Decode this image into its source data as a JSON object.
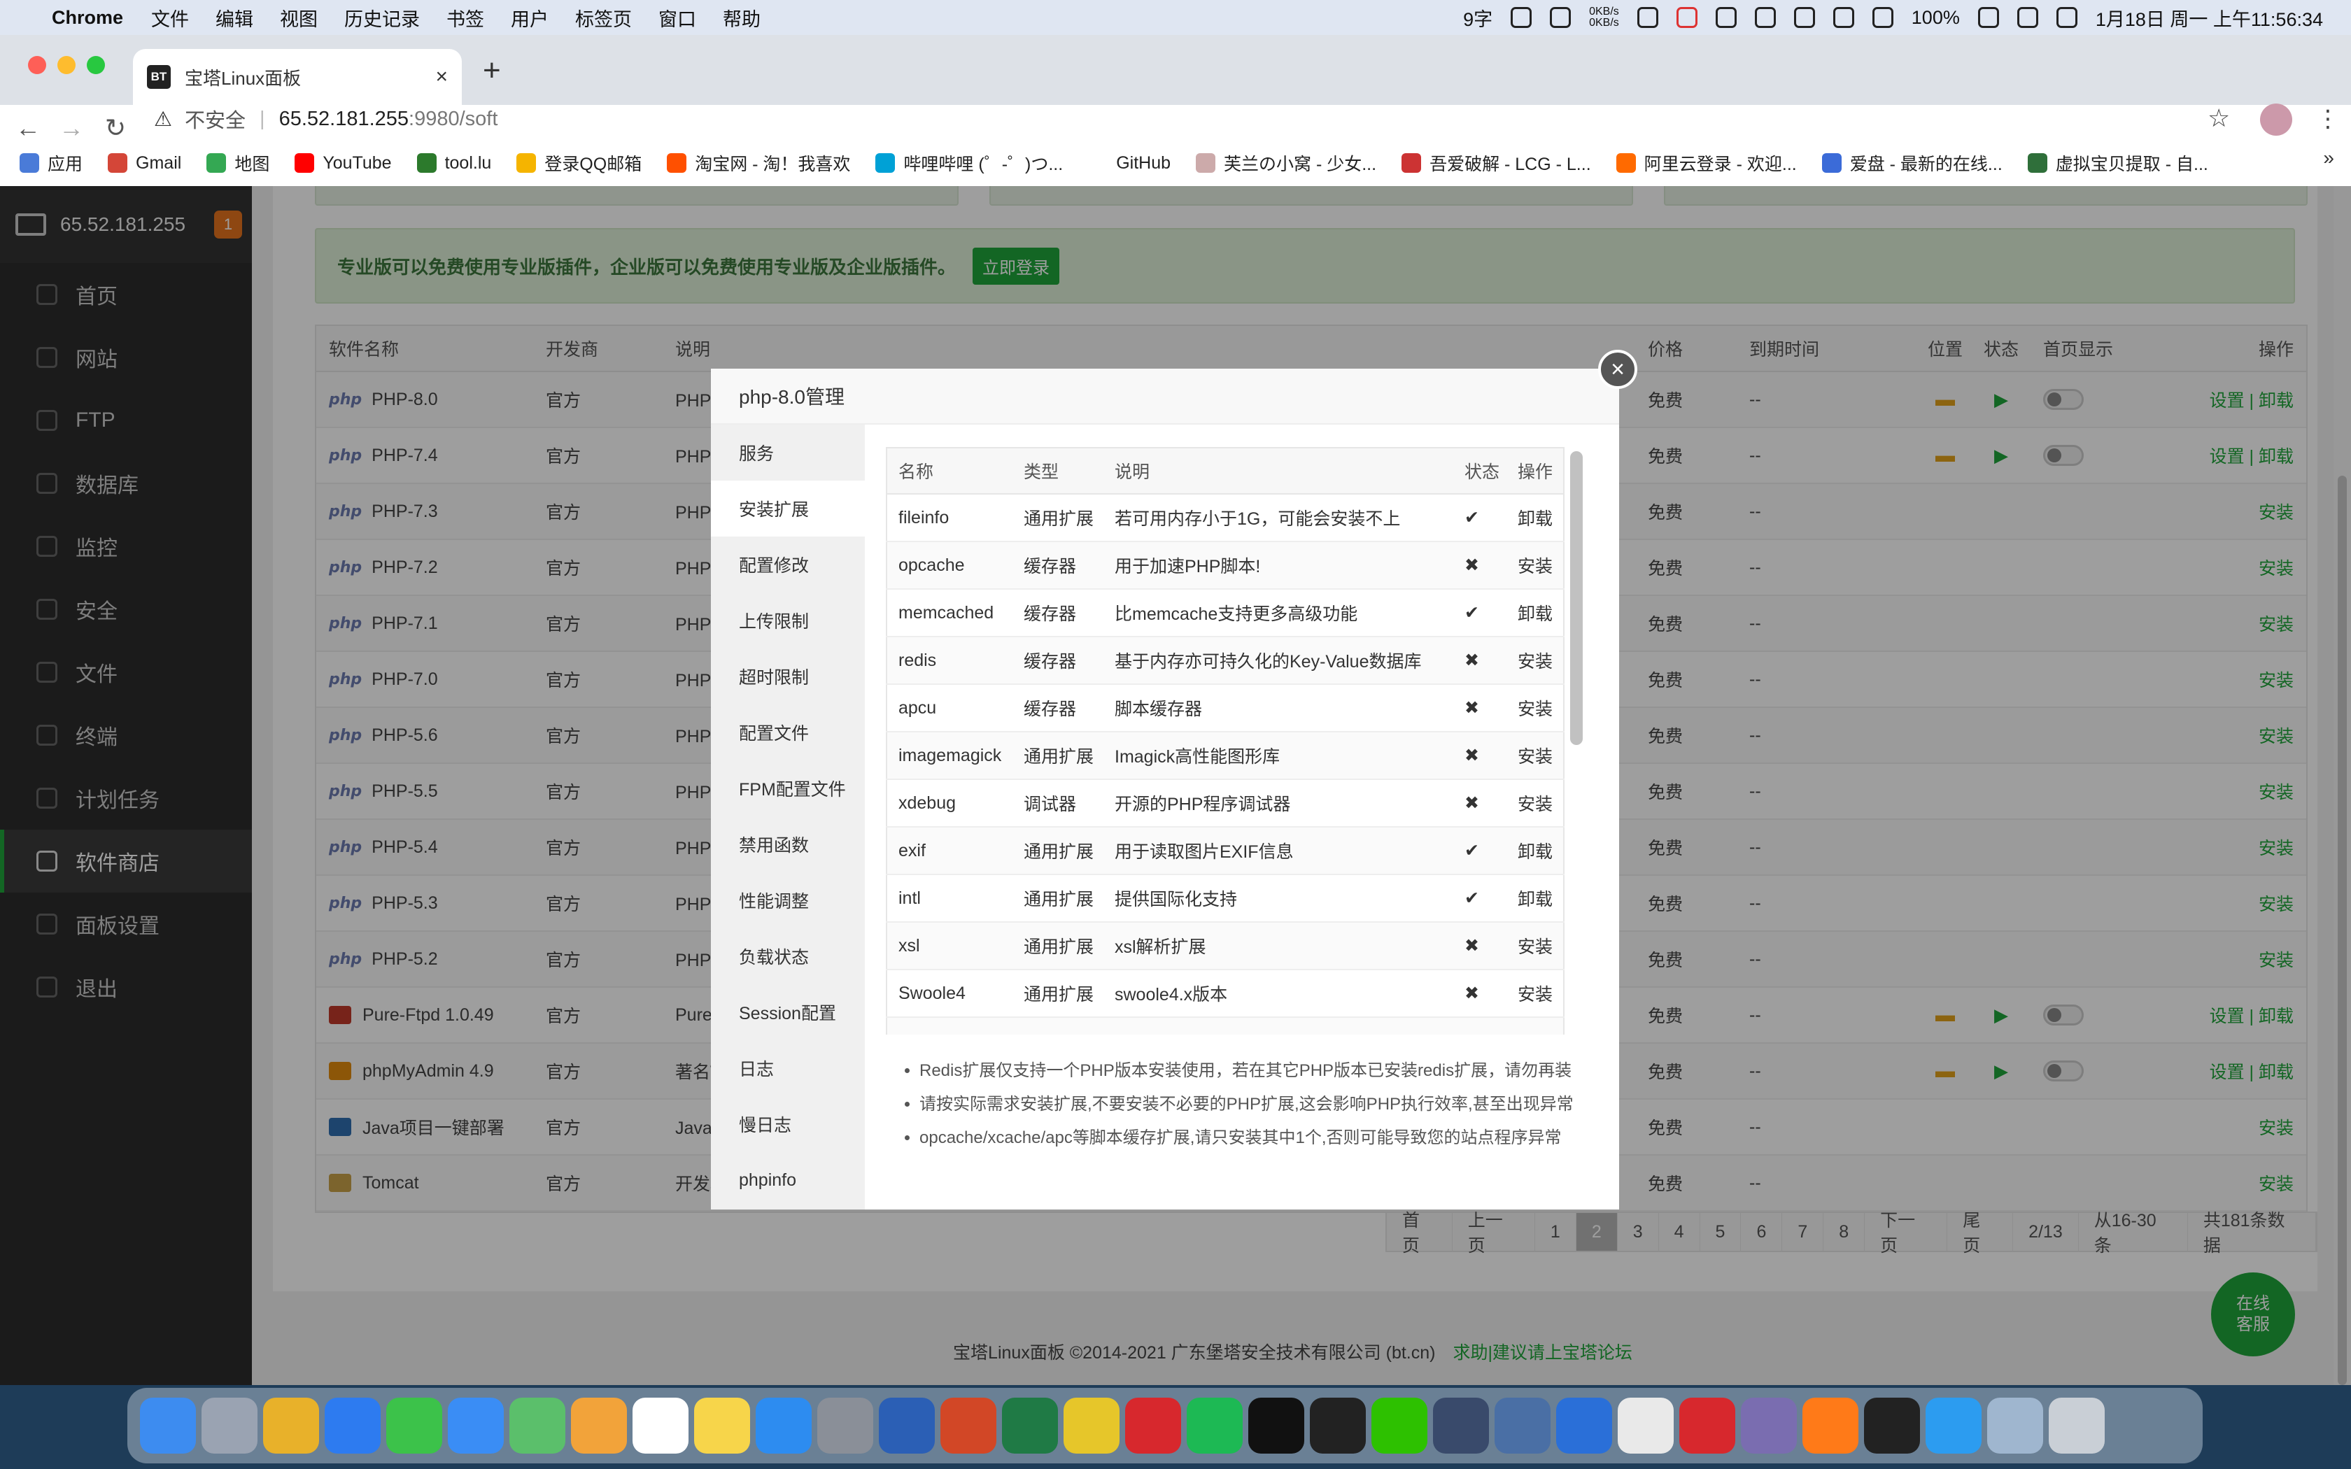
{
  "menubar": {
    "app_name": "Chrome",
    "menus": [
      "文件",
      "编辑",
      "视图",
      "历史记录",
      "书签",
      "用户",
      "标签页",
      "窗口",
      "帮助"
    ],
    "status": {
      "ime": "9字",
      "net": "0KB/s\n0KB/s",
      "battery": "100%",
      "clock": "1月18日 周一 上午11:56:34"
    }
  },
  "browser": {
    "tab_title": "宝塔Linux面板",
    "tab_favicon": "BT",
    "insecure_label": "不安全",
    "url_host": "65.52.181.255",
    "url_path": ":9980/soft",
    "bookmarks": [
      {
        "label": "应用",
        "color": "#4a7bd8"
      },
      {
        "label": "Gmail",
        "color": "#d44638"
      },
      {
        "label": "地图",
        "color": "#34a853"
      },
      {
        "label": "YouTube",
        "color": "#ff0000"
      },
      {
        "label": "tool.lu",
        "color": "#2c7a2c"
      },
      {
        "label": "登录QQ邮箱",
        "color": "#f5b400"
      },
      {
        "label": "淘宝网 - 淘！我喜欢",
        "color": "#ff5000"
      },
      {
        "label": "哔哩哔哩 (゜-゜)つ...",
        "color": "#00a1d6"
      },
      {
        "label": "GitHub",
        "color": "#ffffff"
      },
      {
        "label": "芙兰の小窝 - 少女...",
        "color": "#caa"
      },
      {
        "label": "吾爱破解 - LCG - L...",
        "color": "#c33"
      },
      {
        "label": "阿里云登录 - 欢迎...",
        "color": "#ff6a00"
      },
      {
        "label": "爱盘 - 最新的在线...",
        "color": "#3b6bd8"
      },
      {
        "label": "虚拟宝贝提取 - 自...",
        "color": "#2f6f3a"
      }
    ]
  },
  "sidebar": {
    "server_ip": "65.52.181.255",
    "badge": "1",
    "items": [
      {
        "label": "首页"
      },
      {
        "label": "网站"
      },
      {
        "label": "FTP"
      },
      {
        "label": "数据库"
      },
      {
        "label": "监控"
      },
      {
        "label": "安全"
      },
      {
        "label": "文件"
      },
      {
        "label": "终端"
      },
      {
        "label": "计划任务"
      },
      {
        "label": "软件商店",
        "active": true
      },
      {
        "label": "面板设置"
      },
      {
        "label": "退出"
      }
    ]
  },
  "notice": {
    "text": "专业版可以免费使用专业版插件，企业版可以免费使用专业版及企业版插件。",
    "button": "立即登录"
  },
  "soft_table": {
    "headers": {
      "name": "软件名称",
      "dev": "开发商",
      "desc": "说明",
      "price": "价格",
      "expire": "到期时间",
      "location": "位置",
      "status": "状态",
      "home": "首页显示",
      "ops": "操作"
    },
    "rows": [
      {
        "name": "PHP-8.0",
        "icon": "php",
        "dev": "官方",
        "desc": "PHP是",
        "price": "免费",
        "expire": "--",
        "installed": true,
        "ops": "设置 | 卸载"
      },
      {
        "name": "PHP-7.4",
        "icon": "php",
        "dev": "官方",
        "desc": "PHP是",
        "price": "免费",
        "expire": "--",
        "installed": true,
        "ops": "设置 | 卸载"
      },
      {
        "name": "PHP-7.3",
        "icon": "php",
        "dev": "官方",
        "desc": "PHP是",
        "price": "免费",
        "expire": "--",
        "installed": false,
        "ops": "安装"
      },
      {
        "name": "PHP-7.2",
        "icon": "php",
        "dev": "官方",
        "desc": "PHP是",
        "price": "免费",
        "expire": "--",
        "installed": false,
        "ops": "安装"
      },
      {
        "name": "PHP-7.1",
        "icon": "php",
        "dev": "官方",
        "desc": "PHP是",
        "price": "免费",
        "expire": "--",
        "installed": false,
        "ops": "安装"
      },
      {
        "name": "PHP-7.0",
        "icon": "php",
        "dev": "官方",
        "desc": "PHP是",
        "price": "免费",
        "expire": "--",
        "installed": false,
        "ops": "安装"
      },
      {
        "name": "PHP-5.6",
        "icon": "php",
        "dev": "官方",
        "desc": "PHP是",
        "price": "免费",
        "expire": "--",
        "installed": false,
        "ops": "安装"
      },
      {
        "name": "PHP-5.5",
        "icon": "php",
        "dev": "官方",
        "desc": "PHP是",
        "price": "免费",
        "expire": "--",
        "installed": false,
        "ops": "安装"
      },
      {
        "name": "PHP-5.4",
        "icon": "php",
        "dev": "官方",
        "desc": "PHP是",
        "price": "免费",
        "expire": "--",
        "installed": false,
        "ops": "安装"
      },
      {
        "name": "PHP-5.3",
        "icon": "php",
        "dev": "官方",
        "desc": "PHP是",
        "price": "免费",
        "expire": "--",
        "installed": false,
        "ops": "安装"
      },
      {
        "name": "PHP-5.2",
        "icon": "php",
        "dev": "官方",
        "desc": "PHP是",
        "price": "免费",
        "expire": "--",
        "installed": false,
        "ops": "安装"
      },
      {
        "name": "Pure-Ftpd 1.0.49",
        "icon": "ftp",
        "dev": "官方",
        "desc": "PureF",
        "price": "免费",
        "expire": "--",
        "installed": true,
        "ops": "设置 | 卸载"
      },
      {
        "name": "phpMyAdmin 4.9",
        "icon": "pma",
        "dev": "官方",
        "desc": "著名W",
        "price": "免费",
        "expire": "--",
        "installed": true,
        "ops": "设置 | 卸载"
      },
      {
        "name": "Java项目一键部署",
        "icon": "java",
        "dev": "官方",
        "desc": "Java项",
        "price": "免费",
        "expire": "--",
        "installed": false,
        "ops": "安装"
      },
      {
        "name": "Tomcat",
        "icon": "tomcat",
        "dev": "官方",
        "desc": "开发和",
        "price": "免费",
        "expire": "--",
        "installed": false,
        "ops": "安装"
      }
    ]
  },
  "pager": [
    "首页",
    "上一页",
    "1",
    "2",
    "3",
    "4",
    "5",
    "6",
    "7",
    "8",
    "下一页",
    "尾页",
    "2/13",
    "从16-30条",
    "共181条数据"
  ],
  "pager_current": "2",
  "footer": {
    "copyright": "宝塔Linux面板 ©2014-2021 广东堡塔安全技术有限公司 (bt.cn)",
    "link": "求助|建议请上宝塔论坛"
  },
  "online_service": "在线\n客服",
  "modal": {
    "title": "php-8.0管理",
    "close_icon": "×",
    "nav": [
      "服务",
      "安装扩展",
      "配置修改",
      "上传限制",
      "超时限制",
      "配置文件",
      "FPM配置文件",
      "禁用函数",
      "性能调整",
      "负载状态",
      "Session配置",
      "日志",
      "慢日志",
      "phpinfo"
    ],
    "nav_active": "安装扩展",
    "ext_headers": {
      "name": "名称",
      "type": "类型",
      "desc": "说明",
      "status": "状态",
      "op": "操作"
    },
    "extensions": [
      {
        "name": "fileinfo",
        "type": "通用扩展",
        "desc": "若可用内存小于1G，可能会安装不上",
        "status": "✔",
        "op": "卸载",
        "installed": true
      },
      {
        "name": "opcache",
        "type": "缓存器",
        "desc": "用于加速PHP脚本!",
        "status": "✖",
        "op": "安装",
        "installed": false
      },
      {
        "name": "memcached",
        "type": "缓存器",
        "desc": "比memcache支持更多高级功能",
        "status": "✔",
        "op": "卸载",
        "installed": true
      },
      {
        "name": "redis",
        "type": "缓存器",
        "desc": "基于内存亦可持久化的Key-Value数据库",
        "status": "✖",
        "op": "安装",
        "installed": false
      },
      {
        "name": "apcu",
        "type": "缓存器",
        "desc": "脚本缓存器",
        "status": "✖",
        "op": "安装",
        "installed": false
      },
      {
        "name": "imagemagick",
        "type": "通用扩展",
        "desc": "Imagick高性能图形库",
        "status": "✖",
        "op": "安装",
        "installed": false
      },
      {
        "name": "xdebug",
        "type": "调试器",
        "desc": "开源的PHP程序调试器",
        "status": "✖",
        "op": "安装",
        "installed": false
      },
      {
        "name": "exif",
        "type": "通用扩展",
        "desc": "用于读取图片EXIF信息",
        "status": "✔",
        "op": "卸载",
        "installed": true
      },
      {
        "name": "intl",
        "type": "通用扩展",
        "desc": "提供国际化支持",
        "status": "✔",
        "op": "卸载",
        "installed": true
      },
      {
        "name": "xsl",
        "type": "通用扩展",
        "desc": "xsl解析扩展",
        "status": "✖",
        "op": "安装",
        "installed": false
      },
      {
        "name": "Swoole4",
        "type": "通用扩展",
        "desc": "swoole4.x版本",
        "status": "✖",
        "op": "安装",
        "installed": false
      }
    ],
    "tips": [
      "Redis扩展仅支持一个PHP版本安装使用，若在其它PHP版本已安装redis扩展，请勿再装",
      "请按实际需求安装扩展,不要安装不必要的PHP扩展,这会影响PHP执行效率,甚至出现异常",
      "opcache/xcache/apc等脚本缓存扩展,请只安装其中1个,否则可能导致您的站点程序异常"
    ]
  },
  "dock": [
    {
      "name": "finder",
      "color": "#3d8cf0"
    },
    {
      "name": "launchpad",
      "color": "#9aa3b2"
    },
    {
      "name": "chrome",
      "color": "#e8b12a"
    },
    {
      "name": "safari",
      "color": "#2d7bf0"
    },
    {
      "name": "messages",
      "color": "#3cc24a"
    },
    {
      "name": "mail",
      "color": "#3a8df5"
    },
    {
      "name": "maps",
      "color": "#5bbf6b"
    },
    {
      "name": "photos",
      "color": "#f2a33a"
    },
    {
      "name": "calendar",
      "color": "#ffffff"
    },
    {
      "name": "notes",
      "color": "#f7d54a"
    },
    {
      "name": "app-store",
      "color": "#2d8cf0"
    },
    {
      "name": "system-preferences",
      "color": "#8a8f98"
    },
    {
      "name": "word",
      "color": "#2b5fb5"
    },
    {
      "name": "powerpoint",
      "color": "#d24726"
    },
    {
      "name": "excel",
      "color": "#1f7a45"
    },
    {
      "name": "music",
      "color": "#e6c62a"
    },
    {
      "name": "netease-music",
      "color": "#d7282d"
    },
    {
      "name": "spotify",
      "color": "#1db954"
    },
    {
      "name": "qq",
      "color": "#111111"
    },
    {
      "name": "qq-2",
      "color": "#222222"
    },
    {
      "name": "wechat",
      "color": "#2dc100"
    },
    {
      "name": "cloud-app",
      "color": "#394a6b"
    },
    {
      "name": "screen-app",
      "color": "#4a6fa5"
    },
    {
      "name": "windows-app",
      "color": "#2a6fd8"
    },
    {
      "name": "textedit",
      "color": "#e9e9e9"
    },
    {
      "name": "netease-music-2",
      "color": "#d7282d"
    },
    {
      "name": "archive",
      "color": "#7a6db0"
    },
    {
      "name": "firefox",
      "color": "#ff7a18"
    },
    {
      "name": "terminal",
      "color": "#222222"
    },
    {
      "name": "vscode",
      "color": "#2c9cf0"
    },
    {
      "name": "downloads",
      "color": "#9fb6cf"
    },
    {
      "name": "trash",
      "color": "#c9cfd6"
    }
  ]
}
